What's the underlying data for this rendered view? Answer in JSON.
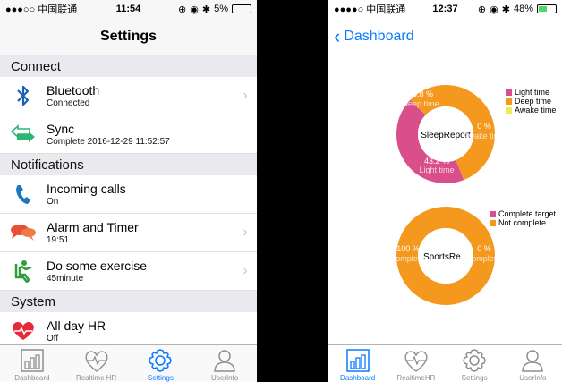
{
  "left": {
    "status": {
      "carrier": "●●●○○ 中国联通",
      "time": "11:54",
      "battery": "5%",
      "battery_level": 0.05
    },
    "title": "Settings",
    "sections": [
      {
        "header": "Connect",
        "rows": [
          {
            "title": "Bluetooth",
            "sub": "Connected",
            "icon": "bluetooth-icon",
            "chevron": true
          },
          {
            "title": "Sync",
            "sub": "Complete  2016-12-29 11:52:57",
            "icon": "sync-icon",
            "chevron": false
          }
        ]
      },
      {
        "header": "Notifications",
        "rows": [
          {
            "title": "Incoming calls",
            "sub": "On",
            "icon": "phone-icon",
            "chevron": false
          },
          {
            "title": "Alarm and Timer",
            "sub": "19:51",
            "icon": "chat-bubbles-icon",
            "chevron": true
          },
          {
            "title": "Do some exercise",
            "sub": "45minute",
            "icon": "seat-exercise-icon",
            "chevron": true
          }
        ]
      },
      {
        "header": "System",
        "rows": [
          {
            "title": "All day HR",
            "sub": "Off",
            "icon": "heart-icon",
            "chevron": false
          }
        ]
      }
    ],
    "tabs": [
      {
        "label": "Dashboard",
        "icon": "bar-chart-icon",
        "active": false
      },
      {
        "label": "Realtime HR",
        "icon": "heartbeat-icon",
        "active": false
      },
      {
        "label": "Settings",
        "icon": "gear-icon",
        "active": true
      },
      {
        "label": "UserInfo",
        "icon": "user-icon",
        "active": false
      }
    ]
  },
  "right": {
    "status": {
      "carrier": "●●●●○ 中国联通",
      "time": "12:37",
      "battery": "48%",
      "battery_level": 0.48
    },
    "back_label": "Dashboard",
    "tabs": [
      {
        "label": "Dashboard",
        "icon": "bar-chart-icon",
        "active": true
      },
      {
        "label": "RealtimeHR",
        "icon": "heartbeat-icon",
        "active": false
      },
      {
        "label": "Settings",
        "icon": "gear-icon",
        "active": false
      },
      {
        "label": "UserInfo",
        "icon": "user-icon",
        "active": false
      }
    ]
  },
  "chart_data": [
    {
      "type": "pie",
      "title": "SleepReport",
      "categories": [
        "Light time",
        "Deep time",
        "Awake time"
      ],
      "values": [
        43.2,
        56.8,
        0.0
      ],
      "slice_labels": [
        "43.2 %",
        "56.8 %",
        "0 %"
      ],
      "slice_names": [
        "Light time",
        "Deep time",
        "Awake time"
      ],
      "colors": [
        "#d94f8c",
        "#f5981e",
        "#f2ea57"
      ],
      "legend": "top-right"
    },
    {
      "type": "pie",
      "title": "SportsRe...",
      "categories": [
        "Complete target",
        "Not complete"
      ],
      "values": [
        0.0,
        100.0
      ],
      "slice_labels": [
        "0 %",
        "100 %"
      ],
      "slice_names": [
        "complete",
        "complete"
      ],
      "colors": [
        "#d94f8c",
        "#f5981e"
      ],
      "legend": "top-right"
    }
  ]
}
